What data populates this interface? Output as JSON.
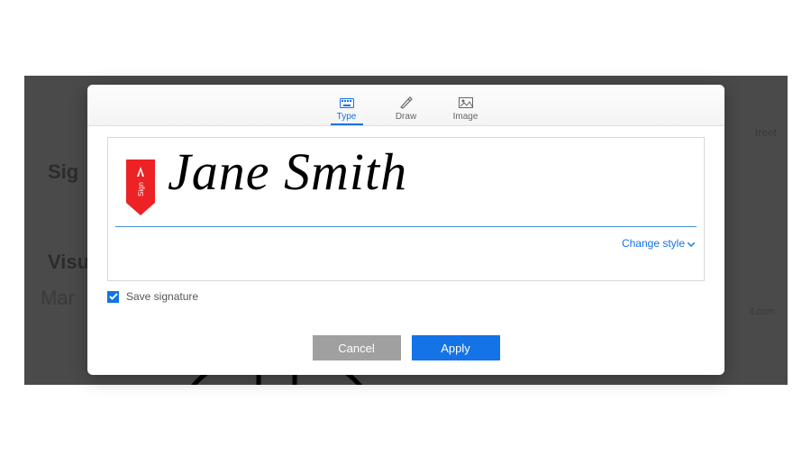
{
  "tabs": {
    "type": "Type",
    "draw": "Draw",
    "image": "Image"
  },
  "signature": {
    "tag_label": "Sign",
    "text": "Jane Smith",
    "change_style": "Change style"
  },
  "save": {
    "label": "Save signature",
    "checked": true
  },
  "buttons": {
    "cancel": "Cancel",
    "apply": "Apply"
  },
  "background": {
    "sig": "Sig",
    "visu": "Visu",
    "mar": "Mar",
    "street": "treet",
    "com": "il.com"
  }
}
